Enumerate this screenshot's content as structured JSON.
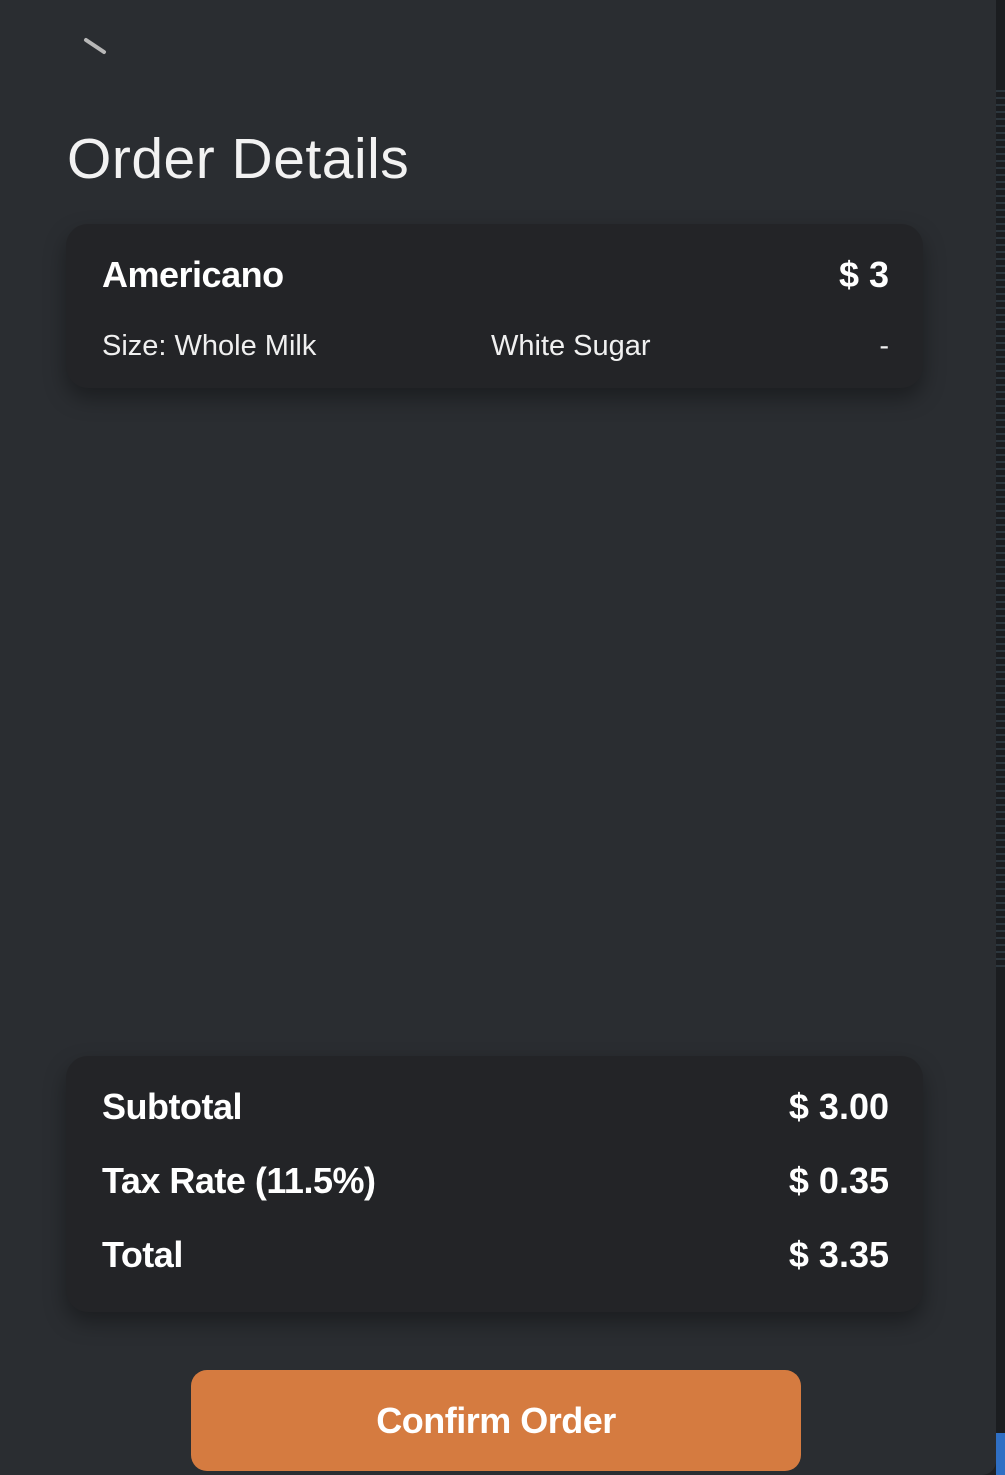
{
  "header": {
    "back_icon": "back-arrow-icon",
    "title": "Order Details"
  },
  "order_items": [
    {
      "name": "Americano",
      "price": "$ 3",
      "size": "Size: Whole Milk",
      "sugar": "White Sugar",
      "extra": "-"
    }
  ],
  "summary": {
    "subtotal_label": "Subtotal",
    "subtotal_value": "$ 3.00",
    "tax_label": "Tax Rate (11.5%)",
    "tax_value": "$ 0.35",
    "total_label": "Total",
    "total_value": "$ 3.35"
  },
  "actions": {
    "confirm_label": "Confirm Order"
  },
  "colors": {
    "background": "#2a2d31",
    "card": "#232427",
    "accent": "#d57b40",
    "text": "#ffffff"
  }
}
